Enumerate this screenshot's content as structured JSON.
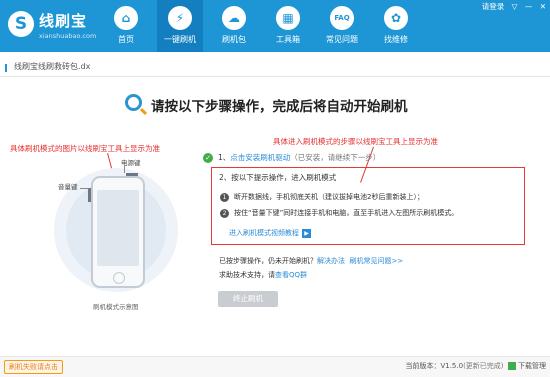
{
  "app": {
    "logo_mark": "S",
    "name": "线刷宝",
    "subtitle": "xianshuabao.com"
  },
  "topbar": {
    "login": "请登录",
    "menu": "▽",
    "minimize": "—",
    "close": "✕"
  },
  "nav": [
    {
      "label": "首页",
      "icon": "⌂"
    },
    {
      "label": "一键刷机",
      "icon": "⚡"
    },
    {
      "label": "刷机包",
      "icon": "☁"
    },
    {
      "label": "工具箱",
      "icon": "▦"
    },
    {
      "label": "常见问题",
      "icon": "FAQ"
    },
    {
      "label": "找维修",
      "icon": "✿"
    }
  ],
  "breadcrumb": "线刷宝线刷救砖包.dx",
  "main": {
    "title": "请按以下步骤操作，完成后将自动开始刷机",
    "note_left": "具体刷机模式的图片以线刷宝工具上显示为准",
    "note_right": "具体进入刷机模式的步骤以线刷宝工具上显示为准",
    "label_power": "电源键",
    "label_volume": "音量键",
    "phone_caption": "刷机模式示意图",
    "step1_prefix": "1、",
    "step1_link": "点击安装刷机驱动",
    "step1_note": "（已安装，请继续下一步）",
    "step2_title": "2、按以下提示操作，进入刷机模式",
    "step2_items": [
      {
        "num": "1",
        "text": "断开数据线，手机彻底关机（建议拔掉电池2秒后重新装上）；"
      },
      {
        "num": "2",
        "text": "按住“音量下键”同时连接手机和电脑，直至手机进入左图所示刷机模式。"
      }
    ],
    "video_link": "进入刷机模式视频教程",
    "video_icon": "▶",
    "help_text": "已按步骤操作，仍未开始刷机？",
    "help_link1": "解决办法",
    "help_link2": "刷机常见问题>>",
    "support_text": "求助技术支持，请",
    "support_link": "查看QQ群",
    "stop_button": "终止刷机"
  },
  "footer": {
    "feedback": "刷机失败请点击",
    "version_label": "当前版本：",
    "version": "V1.5.0",
    "version_status": "(更新已完成)",
    "download": "下载管理"
  },
  "colors": {
    "header": "#1e96d6",
    "accent_red": "#e53935",
    "link": "#2b8bd6"
  }
}
